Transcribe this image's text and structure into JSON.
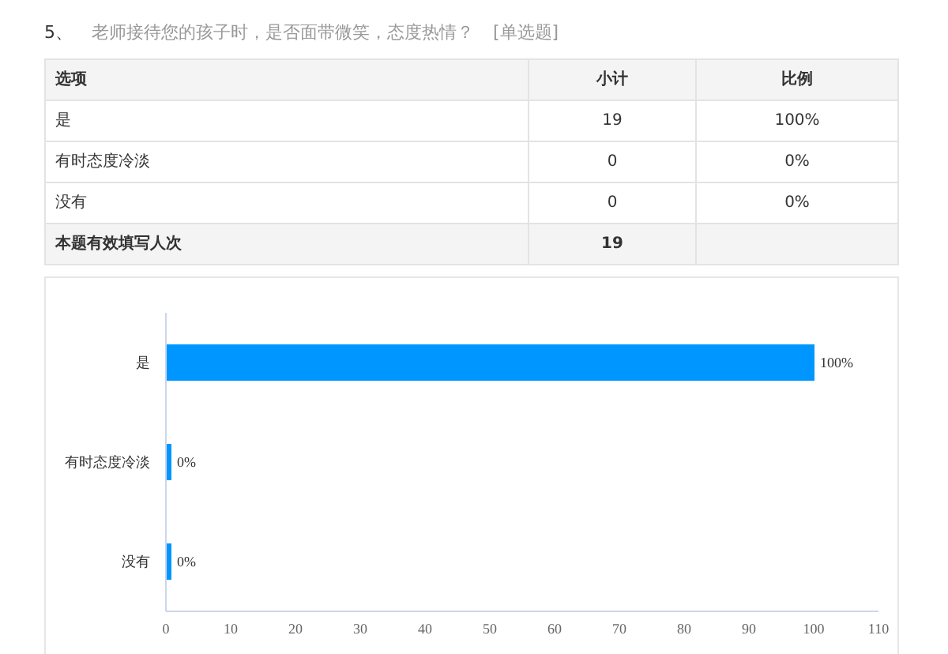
{
  "question": {
    "number": "5、",
    "text": "老师接待您的孩子时，是否面带微笑，态度热情？",
    "type_tag": "[单选题]"
  },
  "table": {
    "columns": [
      "选项",
      "小计",
      "比例"
    ],
    "rows": [
      [
        "是",
        "19",
        "100%"
      ],
      [
        "有时态度冷淡",
        "0",
        "0%"
      ],
      [
        "没有",
        "0",
        "0%"
      ]
    ],
    "total": {
      "label": "本题有效填写人次",
      "count": "19"
    }
  },
  "chart_data": {
    "type": "bar",
    "orientation": "horizontal",
    "categories": [
      "是",
      "有时态度冷淡",
      "没有"
    ],
    "series": [
      {
        "color": "#0096ff",
        "values": [
          100,
          0,
          0
        ]
      }
    ],
    "xlim": [
      0,
      110
    ],
    "xticks": [
      0,
      10,
      20,
      30,
      40,
      50,
      60,
      70,
      80,
      90,
      100,
      110
    ],
    "value_labels": [
      "100%",
      "0%",
      "0%"
    ]
  }
}
